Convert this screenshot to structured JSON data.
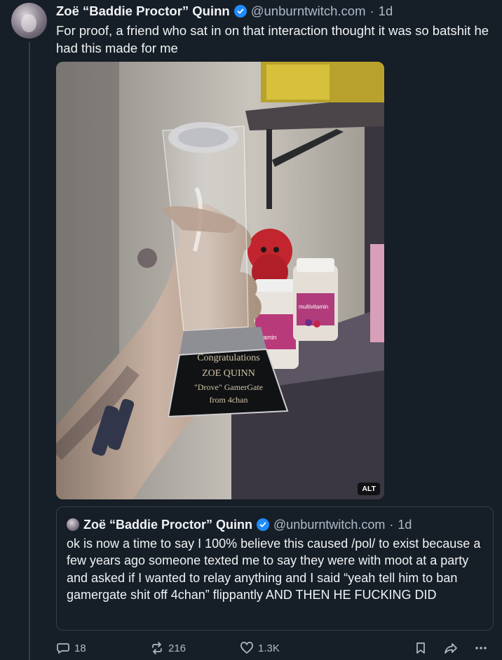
{
  "post": {
    "author_name": "Zoë “Baddie Proctor” Quinn",
    "handle": "@unburntwitch.com",
    "separator": "·",
    "time": "1d",
    "text": "For proof, a friend who sat in on that interaction thought it was so batshit he had this made for me"
  },
  "media": {
    "alt_badge": "ALT",
    "plaque_lines": [
      "Congratulations",
      "ZOE QUINN",
      "\"Drove\" GamerGate",
      "from 4chan"
    ],
    "bottle_label": "multivitamin",
    "bottle_label_2": "amin"
  },
  "quote": {
    "author_name": "Zoë “Baddie Proctor” Quinn",
    "handle": "@unburntwitch.com",
    "separator": "·",
    "time": "1d",
    "text": "ok is now a time to say I 100% believe this caused /pol/ to exist because a few years ago someone texted me to say they were with moot at a party and asked if I wanted to relay anything and I said “yeah tell him to ban gamergate shit off 4chan” flippantly AND THEN HE FUCKING DID"
  },
  "actions": {
    "replies": "18",
    "reposts": "216",
    "likes": "1.3K"
  },
  "colors": {
    "background": "#161e27",
    "text": "#f1f3f5",
    "muted": "#aebbc9",
    "border": "#2e4052",
    "verified": "#208bfe"
  },
  "icons": [
    "verified-icon",
    "reply-icon",
    "repost-icon",
    "like-icon",
    "bookmark-icon",
    "share-icon",
    "more-icon"
  ]
}
